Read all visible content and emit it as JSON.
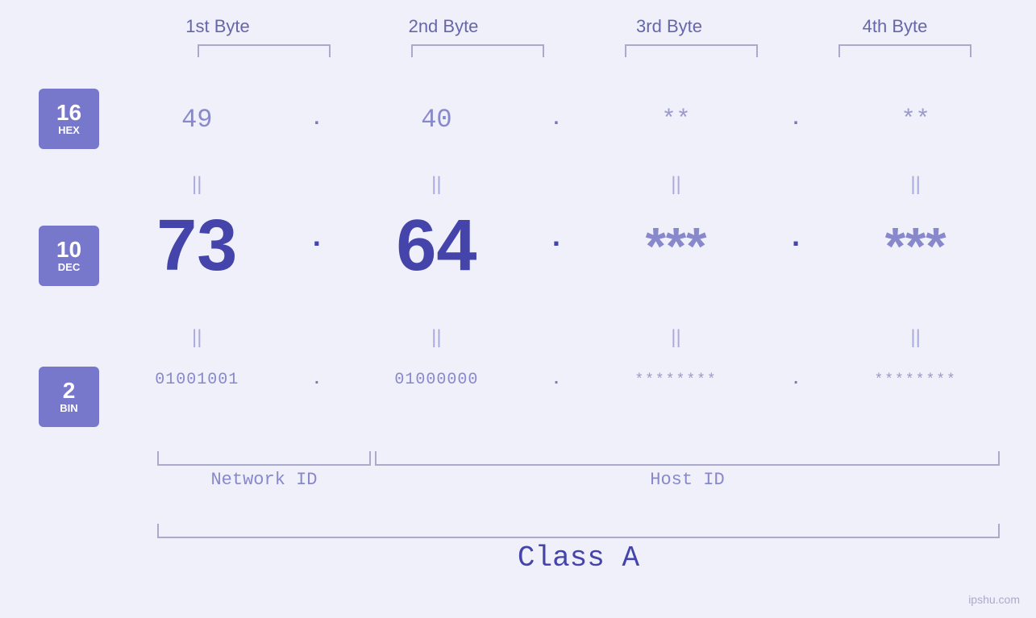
{
  "headers": {
    "byte1": "1st Byte",
    "byte2": "2nd Byte",
    "byte3": "3rd Byte",
    "byte4": "4th Byte"
  },
  "badges": {
    "hex": {
      "number": "16",
      "label": "HEX"
    },
    "dec": {
      "number": "10",
      "label": "DEC"
    },
    "bin": {
      "number": "2",
      "label": "BIN"
    }
  },
  "values": {
    "hex": {
      "b1": "49",
      "b2": "40",
      "b3": "**",
      "b4": "**"
    },
    "dec": {
      "b1": "73",
      "b2": "64",
      "b3": "***",
      "b4": "***"
    },
    "bin": {
      "b1": "01001001",
      "b2": "01000000",
      "b3": "********",
      "b4": "********"
    }
  },
  "labels": {
    "networkId": "Network ID",
    "hostId": "Host ID",
    "classA": "Class A"
  },
  "watermark": "ipshu.com",
  "equals": "||"
}
